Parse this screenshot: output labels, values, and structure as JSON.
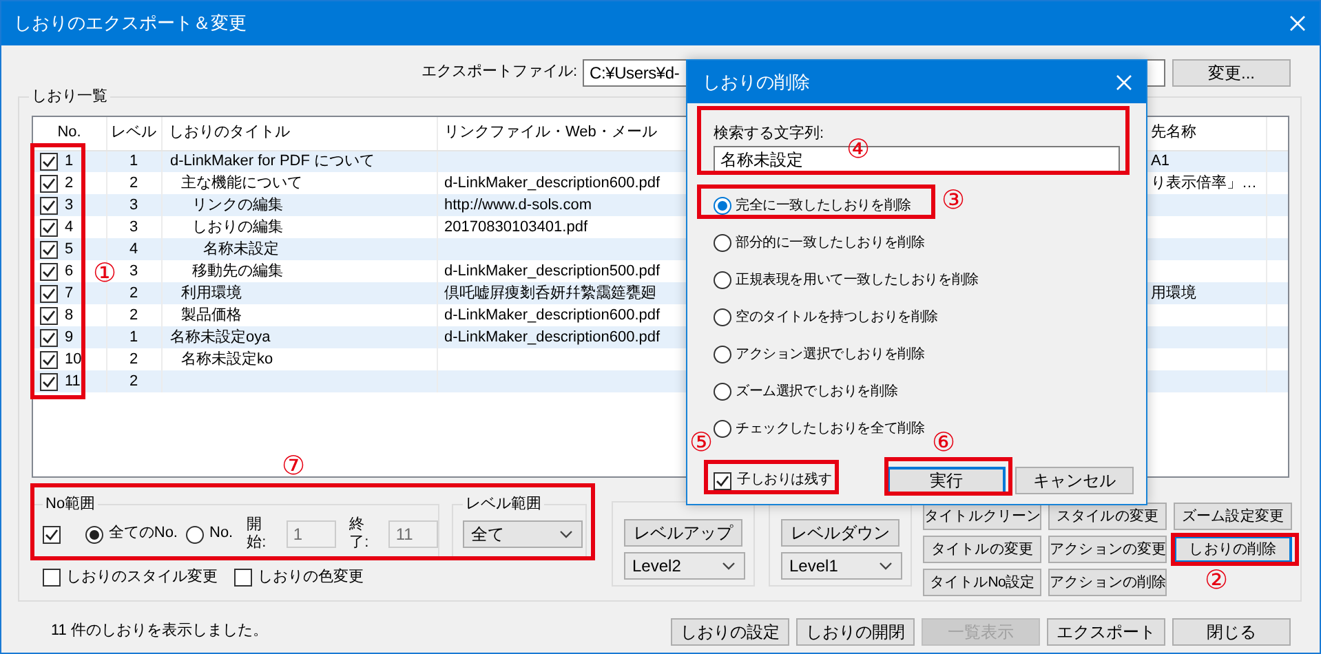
{
  "window": {
    "title": "しおりのエクスポート＆変更"
  },
  "export_file": {
    "label": "エクスポートファイル:",
    "value": "C:¥Users¥d-",
    "button": "変更..."
  },
  "bookmark_list": {
    "title": "しおり一覧",
    "columns": [
      "No.",
      "レベル",
      "しおりのタイトル",
      "リンクファイル・Web・メール",
      "先名称"
    ],
    "rows": [
      {
        "checked": true,
        "no": "1",
        "level": "1",
        "title": "d-LinkMaker for PDF について",
        "column_5": "A1"
      },
      {
        "checked": true,
        "no": "2",
        "level": "2",
        "title": "主な機能について",
        "link": "d-LinkMaker_description600.pdf",
        "column_5": "り表示倍率」…"
      },
      {
        "checked": true,
        "no": "3",
        "level": "3",
        "title": "リンクの編集",
        "link": "http://www.d-sols.com"
      },
      {
        "checked": true,
        "no": "4",
        "level": "3",
        "title": "しおりの編集",
        "link": "20170830103401.pdf"
      },
      {
        "checked": true,
        "no": "5",
        "level": "4",
        "title": "名称未設定"
      },
      {
        "checked": true,
        "no": "6",
        "level": "3",
        "title": "移動先の編集",
        "link": "d-LinkMaker_description500.pdf"
      },
      {
        "checked": true,
        "no": "7",
        "level": "2",
        "title": "利用環境",
        "link": "倶吒嘘屛痩剗呑妍幷縶靄筵甕廻",
        "column_5": "用環境"
      },
      {
        "checked": true,
        "no": "8",
        "level": "2",
        "title": "製品価格",
        "link": "d-LinkMaker_description600.pdf"
      },
      {
        "checked": true,
        "no": "9",
        "level": "1",
        "title": "名称未設定oya",
        "link": "d-LinkMaker_description600.pdf"
      },
      {
        "checked": true,
        "no": "10",
        "level": "2",
        "title": "名称未設定ko"
      },
      {
        "checked": true,
        "no": "11",
        "level": "2"
      }
    ]
  },
  "no_range": {
    "title": "No範囲",
    "checked": true,
    "options": [
      {
        "label": "全てのNo.",
        "selected": true
      },
      {
        "label": "No.",
        "selected": false
      }
    ],
    "start_label": "開始:",
    "start_value": "1",
    "end_label": "終了:",
    "end_value": "11",
    "inputs_disabled": true
  },
  "level_range": {
    "title": "レベル範囲",
    "value": "全て"
  },
  "options": [
    {
      "label": "しおりのスタイル変更",
      "checked": false
    },
    {
      "label": "しおりの色変更",
      "checked": false
    }
  ],
  "level_groups": [
    {
      "button": "レベルアップ",
      "value": "Level2"
    },
    {
      "button": "レベルダウン",
      "value": "Level1"
    }
  ],
  "action_buttons": [
    {
      "label": "タイトルクリーン",
      "focused": false
    },
    {
      "label": "スタイルの変更",
      "focused": false
    },
    {
      "label": "ズーム設定変更",
      "focused": false
    },
    {
      "label": "タイトルの変更",
      "focused": false
    },
    {
      "label": "アクションの変更",
      "focused": false
    },
    {
      "label": "しおりの削除",
      "focused": true
    },
    {
      "label": "タイトルNo設定",
      "focused": false
    },
    {
      "label": "アクションの削除",
      "focused": false
    }
  ],
  "status": "11 件のしおりを表示しました。",
  "footer_buttons": [
    {
      "label": "しおりの設定",
      "disabled": false
    },
    {
      "label": "しおりの開閉",
      "disabled": false
    },
    {
      "label": "一覧表示",
      "disabled": true
    },
    {
      "label": "エクスポート",
      "disabled": false
    },
    {
      "label": "閉じる",
      "disabled": false
    }
  ],
  "dialog": {
    "title": "しおりの削除",
    "search_label": "検索する文字列:",
    "search_value": "名称未設定",
    "modes": [
      {
        "label": "完全に一致したしおりを削除",
        "selected": true
      },
      {
        "label": "部分的に一致したしおりを削除",
        "selected": false
      },
      {
        "label": "正規表現を用いて一致したしおりを削除",
        "selected": false
      },
      {
        "label": "空のタイトルを持つしおりを削除",
        "selected": false
      },
      {
        "label": "アクション選択でしおりを削除",
        "selected": false
      },
      {
        "label": "ズーム選択でしおりを削除",
        "selected": false
      },
      {
        "label": "チェックしたしおりを全て削除",
        "selected": false
      }
    ],
    "keep_children": {
      "label": "子しおりは残す",
      "checked": true
    },
    "buttons": [
      {
        "label": "実行",
        "focused": true
      },
      {
        "label": "キャンセル",
        "focused": false
      }
    ]
  },
  "annotations": [
    {
      "label": "①"
    },
    {
      "label": "②"
    },
    {
      "label": "③"
    },
    {
      "label": "④"
    },
    {
      "label": "⑤"
    },
    {
      "label": "⑥"
    },
    {
      "label": "⑦"
    }
  ]
}
